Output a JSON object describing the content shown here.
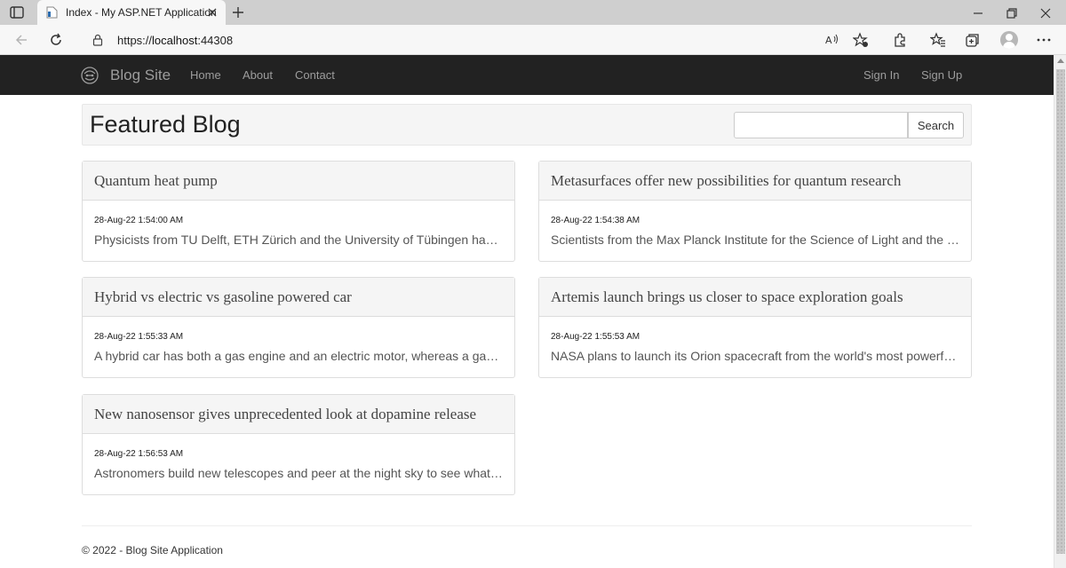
{
  "browser": {
    "tab_title": "Index - My ASP.NET Application",
    "url_scheme": "https://",
    "url_host": "localhost",
    "url_port": ":44308"
  },
  "navbar": {
    "brand": "Blog Site",
    "links": [
      "Home",
      "About",
      "Contact"
    ],
    "right_links": [
      "Sign In",
      "Sign Up"
    ]
  },
  "header": {
    "title": "Featured Blog",
    "search_placeholder": "",
    "search_button": "Search"
  },
  "posts": [
    {
      "title": "Quantum heat pump",
      "date": "28-Aug-22 1:54:00 AM",
      "excerpt": "Physicists from TU Delft, ETH Zürich and the University of Tübingen have developed a quantum heat pump"
    },
    {
      "title": "Metasurfaces offer new possibilities for quantum research",
      "date": "28-Aug-22 1:54:38 AM",
      "excerpt": "Scientists from the Max Planck Institute for the Science of Light and the Sandia National Laboratories"
    },
    {
      "title": "Hybrid vs electric vs gasoline powered car",
      "date": "28-Aug-22 1:55:33 AM",
      "excerpt": "A hybrid car has both a gas engine and an electric motor, whereas a gasoline car only has an engine"
    },
    {
      "title": "Artemis launch brings us closer to space exploration goals",
      "date": "28-Aug-22 1:55:53 AM",
      "excerpt": "NASA plans to launch its Orion spacecraft from the world's most powerful rocket"
    },
    {
      "title": "New nanosensor gives unprecedented look at dopamine release",
      "date": "28-Aug-22 1:56:53 AM",
      "excerpt": "Astronomers build new telescopes and peer at the night sky to see what is out there"
    }
  ],
  "footer": {
    "text": "© 2022 - Blog Site Application"
  },
  "colors": {
    "navbar_bg": "#222222",
    "navbar_text": "#9d9d9d",
    "card_header_bg": "#f5f5f5",
    "card_border": "#dddddd"
  }
}
